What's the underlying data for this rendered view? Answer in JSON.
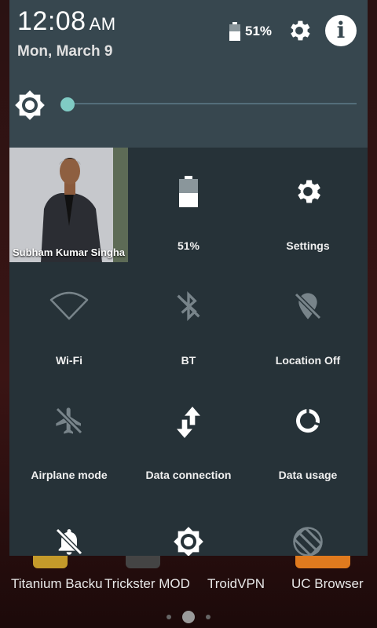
{
  "status": {
    "time": "12:08",
    "ampm": "AM",
    "date": "Mon, March 9",
    "battery_percent": "51%",
    "battery_level": 0.51
  },
  "header": {
    "settings_icon": "gear-icon",
    "info_icon": "info-icon",
    "info_glyph": "i"
  },
  "brightness": {
    "level": 0.02,
    "accent": "#80cbc4"
  },
  "user": {
    "name": "Subham Kumar Singha"
  },
  "tiles": [
    {
      "label": "51%",
      "icon": "battery-icon",
      "active": true
    },
    {
      "label": "Settings",
      "icon": "gear-icon",
      "active": true
    },
    {
      "label": "Wi-Fi",
      "icon": "wifi-icon",
      "active": false
    },
    {
      "label": "BT",
      "icon": "bluetooth-icon",
      "active": false
    },
    {
      "label": "Location Off",
      "icon": "location-off-icon",
      "active": false
    },
    {
      "label": "Airplane mode",
      "icon": "airplane-icon",
      "active": false
    },
    {
      "label": "Data connection",
      "icon": "data-arrows-icon",
      "active": true
    },
    {
      "label": "Data usage",
      "icon": "data-usage-icon",
      "active": true
    },
    {
      "label": "",
      "icon": "notifications-off-icon",
      "active": true
    },
    {
      "label": "",
      "icon": "brightness-icon",
      "active": true
    },
    {
      "label": "",
      "icon": "rotation-lock-icon",
      "active": false
    }
  ],
  "home_apps": [
    {
      "label": "Titanium Backu"
    },
    {
      "label": "Trickster MOD"
    },
    {
      "label": "TroidVPN"
    },
    {
      "label": "UC Browser"
    }
  ],
  "colors": {
    "shade_bg": "#263238",
    "header_bg": "#37474f",
    "inactive_icon": "#78848a"
  }
}
